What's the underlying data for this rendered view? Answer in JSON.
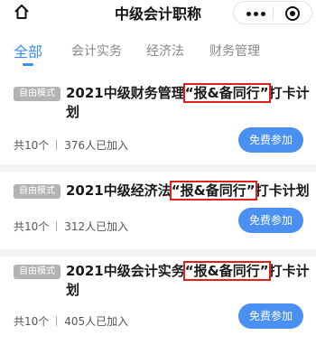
{
  "header": {
    "title": "中级会计职称"
  },
  "tabs": [
    {
      "label": "全部",
      "active": true
    },
    {
      "label": "会计实务",
      "active": false
    },
    {
      "label": "经济法",
      "active": false
    },
    {
      "label": "财务管理",
      "active": false
    }
  ],
  "cards": [
    {
      "badge": "自由模式",
      "title_pre": "2021中级财务管理",
      "title_highlight": "“报&备同行”",
      "title_post": "打卡计划",
      "count": "共10个",
      "joined": "376人已加入",
      "button": "免费参加"
    },
    {
      "badge": "自由模式",
      "title_pre": "2021中级经济法",
      "title_highlight": "“报&备同行”",
      "title_post": "打卡计划",
      "count": "共10个",
      "joined": "312人已加入",
      "button": "免费参加"
    },
    {
      "badge": "自由模式",
      "title_pre": "2021中级会计实务",
      "title_highlight": "“报&备同行”",
      "title_post": "打卡计划",
      "count": "共10个",
      "joined": "405人已加入",
      "button": "免费参加"
    }
  ],
  "colors": {
    "accent": "#3a8cf6",
    "button": "#4a90f3",
    "highlight_box": "#e0201c",
    "badge": "#b3b3b3"
  }
}
